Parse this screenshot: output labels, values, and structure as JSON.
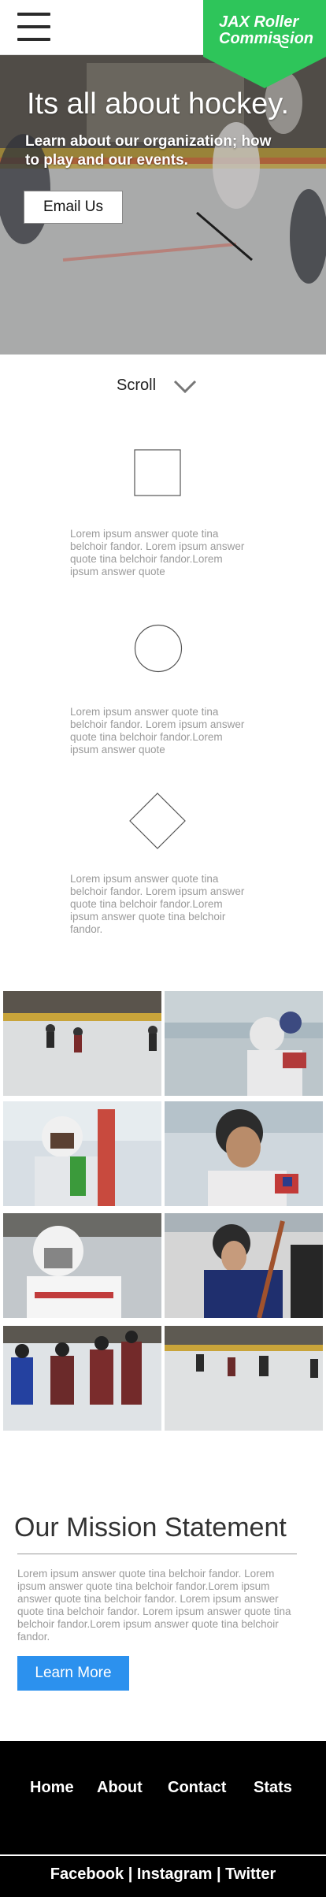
{
  "header": {
    "menu_icon": "hamburger-menu-icon",
    "brand_text": "JAX Roller Commission",
    "brand_color": "#2ec55a"
  },
  "hero": {
    "title": "Its all about hockey.",
    "subtitle": "Learn about our organization; how to play and our events.",
    "button_label": "Email Us"
  },
  "scroll": {
    "label": "Scroll",
    "icon": "chevron-down-icon"
  },
  "features": [
    {
      "icon": "square-icon",
      "text": "Lorem ipsum answer quote tina belchoir fandor. Lorem ipsum answer quote tina belchoir fandor.Lorem ipsum answer quote"
    },
    {
      "icon": "circle-icon",
      "text": "Lorem ipsum answer quote tina belchoir fandor. Lorem ipsum answer quote tina belchoir fandor.Lorem ipsum answer quote"
    },
    {
      "icon": "diamond-icon",
      "text": "Lorem ipsum answer quote tina belchoir fandor. Lorem ipsum answer quote tina belchoir fandor.Lorem ipsum answer quote tina belchoir fandor."
    }
  ],
  "gallery": {
    "photos": [
      "rink-game-photo",
      "player-bench-photo",
      "goalie-photo",
      "smiling-player-photo",
      "masked-goalie-photo",
      "seated-player-photo",
      "team-faceoff-photo",
      "rink-wide-photo"
    ]
  },
  "mission": {
    "title": "Our Mission Statement",
    "text": "Lorem ipsum answer quote tina belchoir fandor. Lorem ipsum answer quote tina belchoir fandor.Lorem ipsum answer quote tina belchoir fandor. Lorem ipsum answer quote tina belchoir fandor. Lorem ipsum answer quote tina belchoir fandor.Lorem ipsum answer quote tina belchoir fandor.",
    "button_label": "Learn More",
    "button_color": "#2c91ee"
  },
  "footer": {
    "nav": [
      "Home",
      "About",
      "Contact",
      "Stats"
    ],
    "social": [
      "Facebook",
      "Instagram",
      "Twitter"
    ],
    "separator": "|"
  }
}
